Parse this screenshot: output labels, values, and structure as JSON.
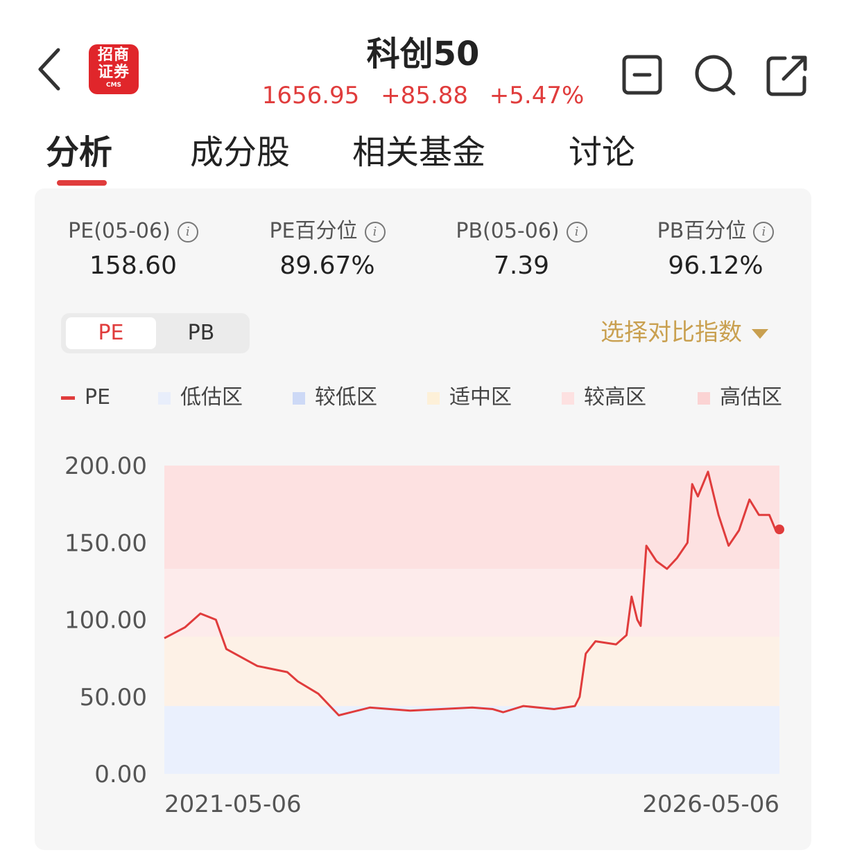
{
  "header": {
    "title": "科创50",
    "logo": {
      "line1": "招商",
      "line2": "证券",
      "sub": "CMS",
      "color": "#e0262b"
    },
    "quote": {
      "price": "1656.95",
      "change": "+85.88",
      "change_pct": "+5.47%",
      "color": "#e03c3c"
    },
    "icons": [
      "back-icon",
      "minus-box-icon",
      "search-icon",
      "share-icon"
    ]
  },
  "tabs": [
    "分析",
    "成分股",
    "相关基金",
    "讨论"
  ],
  "metrics": [
    {
      "label": "PE(05-06)",
      "value": "158.60"
    },
    {
      "label": "PE百分位",
      "value": "89.67%"
    },
    {
      "label": "PB(05-06)",
      "value": "7.39"
    },
    {
      "label": "PB百分位",
      "value": "96.12%"
    }
  ],
  "toggle": {
    "options": [
      "PE",
      "PB"
    ],
    "selected": "PE"
  },
  "compare_label": "选择对比指数",
  "legend": [
    {
      "label": "PE",
      "color": "#e03c3c"
    },
    {
      "label": "低估区",
      "color": "#e8eefb"
    },
    {
      "label": "较低区",
      "color": "#cdd9f6"
    },
    {
      "label": "适中区",
      "color": "#fdf0d8"
    },
    {
      "label": "较高区",
      "color": "#fde1e1"
    },
    {
      "label": "高估区",
      "color": "#fbd3d3"
    }
  ],
  "chart_data": {
    "type": "line",
    "x_start": "2021-05-06",
    "x_end": "2026-05-06",
    "ylim": [
      0,
      200
    ],
    "y_ticks": [
      "200.00",
      "150.00",
      "100.00",
      "50.00",
      "0.00"
    ],
    "x_tick_labels": [
      "2021-05-06",
      "2026-05-06"
    ],
    "zones": [
      {
        "name": "低估区",
        "from": 0,
        "to": 44,
        "color": "#eaf0fd"
      },
      {
        "name": "适中区",
        "from": 44,
        "to": 89,
        "color": "#fdf1e6"
      },
      {
        "name": "较高区",
        "from": 89,
        "to": 133,
        "color": "#fdebeb"
      },
      {
        "name": "高估区",
        "from": 133,
        "to": 200,
        "color": "#fde1e1"
      }
    ],
    "series": [
      {
        "name": "PE",
        "color": "#e03c3c",
        "x": [
          "2021-05-06",
          "2021-07-06",
          "2021-08-21",
          "2021-10-06",
          "2021-11-06",
          "2022-02-06",
          "2022-05-06",
          "2022-06-06",
          "2022-08-06",
          "2022-10-06",
          "2023-01-06",
          "2023-05-06",
          "2023-08-06",
          "2023-11-06",
          "2024-01-06",
          "2024-02-06",
          "2024-04-06",
          "2024-07-06",
          "2024-09-06",
          "2024-09-20",
          "2024-10-08",
          "2024-11-06",
          "2025-01-06",
          "2025-02-06",
          "2025-02-21",
          "2025-03-10",
          "2025-03-20",
          "2025-04-06",
          "2025-05-06",
          "2025-06-06",
          "2025-07-06",
          "2025-08-06",
          "2025-08-20",
          "2025-09-06",
          "2025-10-06",
          "2025-11-06",
          "2025-12-06",
          "2026-01-06",
          "2026-02-06",
          "2026-03-06",
          "2026-04-06",
          "2026-04-25",
          "2026-05-06"
        ],
        "values": [
          88,
          95,
          104,
          100,
          81,
          70,
          66,
          60,
          52,
          38,
          43,
          41,
          42,
          43,
          42,
          40,
          44,
          42,
          44,
          50,
          78,
          86,
          84,
          90,
          115,
          100,
          96,
          148,
          138,
          133,
          140,
          150,
          188,
          180,
          196,
          168,
          148,
          158,
          178,
          168,
          168,
          158,
          158.6
        ]
      }
    ]
  }
}
